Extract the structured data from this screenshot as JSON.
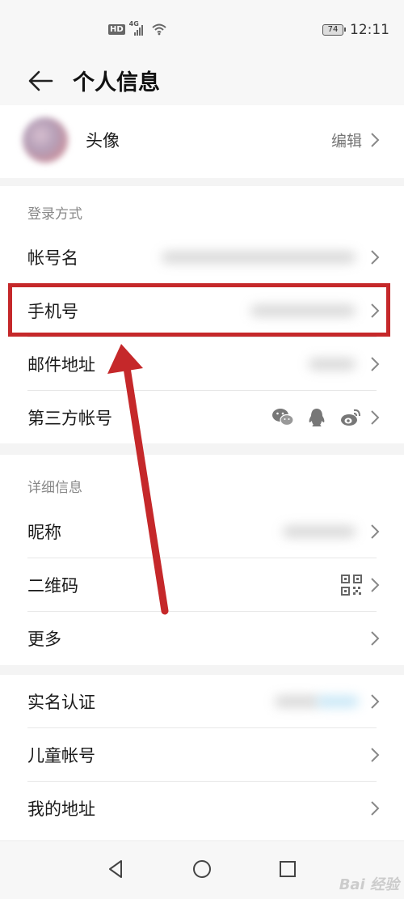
{
  "status_bar": {
    "hd_label": "HD",
    "network_label": "4G",
    "battery": "74",
    "time": "12:11"
  },
  "header": {
    "title": "个人信息"
  },
  "avatar_row": {
    "label": "头像",
    "action_label": "编辑"
  },
  "login_section": {
    "title": "登录方式",
    "items": [
      {
        "label": "帐号名"
      },
      {
        "label": "手机号"
      },
      {
        "label": "邮件地址"
      },
      {
        "label": "第三方帐号",
        "icons": [
          "wechat-icon",
          "qq-icon",
          "weibo-icon"
        ]
      }
    ]
  },
  "detail_section": {
    "title": "详细信息",
    "items": [
      {
        "label": "昵称"
      },
      {
        "label": "二维码",
        "icon": "qr-code-icon"
      },
      {
        "label": "更多"
      }
    ]
  },
  "account_section": {
    "items": [
      {
        "label": "实名认证"
      },
      {
        "label": "儿童帐号"
      },
      {
        "label": "我的地址"
      }
    ]
  },
  "annotation": {
    "highlight_color": "#c5282a"
  },
  "navigation": {
    "buttons": [
      "back-icon",
      "home-icon",
      "recents-icon"
    ]
  },
  "watermark": "Bai 经验"
}
